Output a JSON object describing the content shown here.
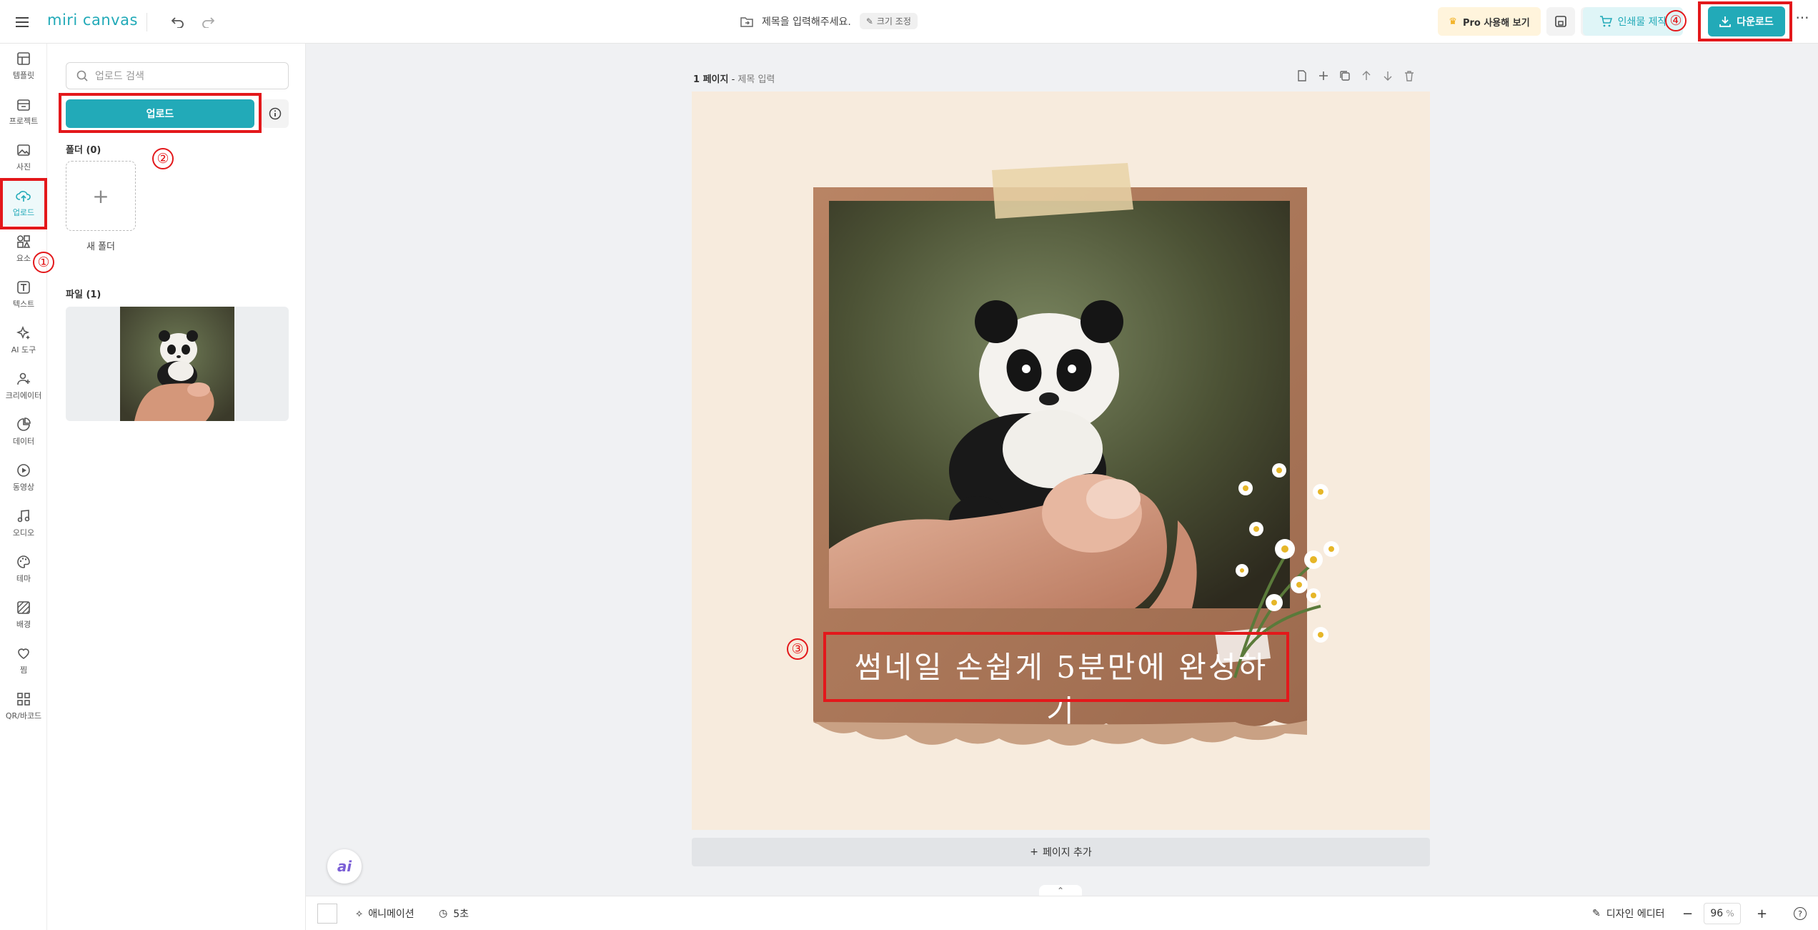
{
  "app": {
    "logo": "miri canvas"
  },
  "header": {
    "doc_title_placeholder": "제목을 입력해주세요.",
    "resize_label": "크기 조정",
    "pro_label": "Pro 사용해 보기",
    "print_label": "인쇄물 제작",
    "download_label": "다운로드"
  },
  "sidebar": {
    "items": [
      {
        "label": "템플릿",
        "icon": "template-icon"
      },
      {
        "label": "프로젝트",
        "icon": "project-icon"
      },
      {
        "label": "사진",
        "icon": "photo-icon"
      },
      {
        "label": "업로드",
        "icon": "upload-cloud-icon",
        "active": true
      },
      {
        "label": "요소",
        "icon": "elements-icon"
      },
      {
        "label": "텍스트",
        "icon": "text-icon"
      },
      {
        "label": "AI 도구",
        "icon": "ai-sparkle-icon"
      },
      {
        "label": "크리에이터",
        "icon": "creator-icon"
      },
      {
        "label": "데이터",
        "icon": "data-chart-icon"
      },
      {
        "label": "동영상",
        "icon": "video-icon"
      },
      {
        "label": "오디오",
        "icon": "audio-icon"
      },
      {
        "label": "테마",
        "icon": "theme-palette-icon"
      },
      {
        "label": "배경",
        "icon": "background-icon"
      },
      {
        "label": "찜",
        "icon": "heart-icon"
      },
      {
        "label": "QR/바코드",
        "icon": "qr-icon"
      }
    ]
  },
  "panel": {
    "search_placeholder": "업로드 검색",
    "upload_button": "업로드",
    "folders_label": "폴더 (0)",
    "new_folder_label": "새 폴더",
    "files_label": "파일 (1)"
  },
  "editor": {
    "page_label": "1 페이지",
    "page_title_placeholder": "제목 입력",
    "canvas_text": "썸네일 손쉽게 5분만에 완성하기",
    "add_page_label": "페이지 추가"
  },
  "bottombar": {
    "animation_label": "애니메이션",
    "duration_label": "5초",
    "design_editor_label": "디자인 에디터",
    "zoom_value": "96",
    "zoom_unit": "%"
  },
  "annotations": [
    "①",
    "②",
    "③",
    "④"
  ],
  "colors": {
    "accent": "#22aab8",
    "annotation": "#e3181b"
  }
}
